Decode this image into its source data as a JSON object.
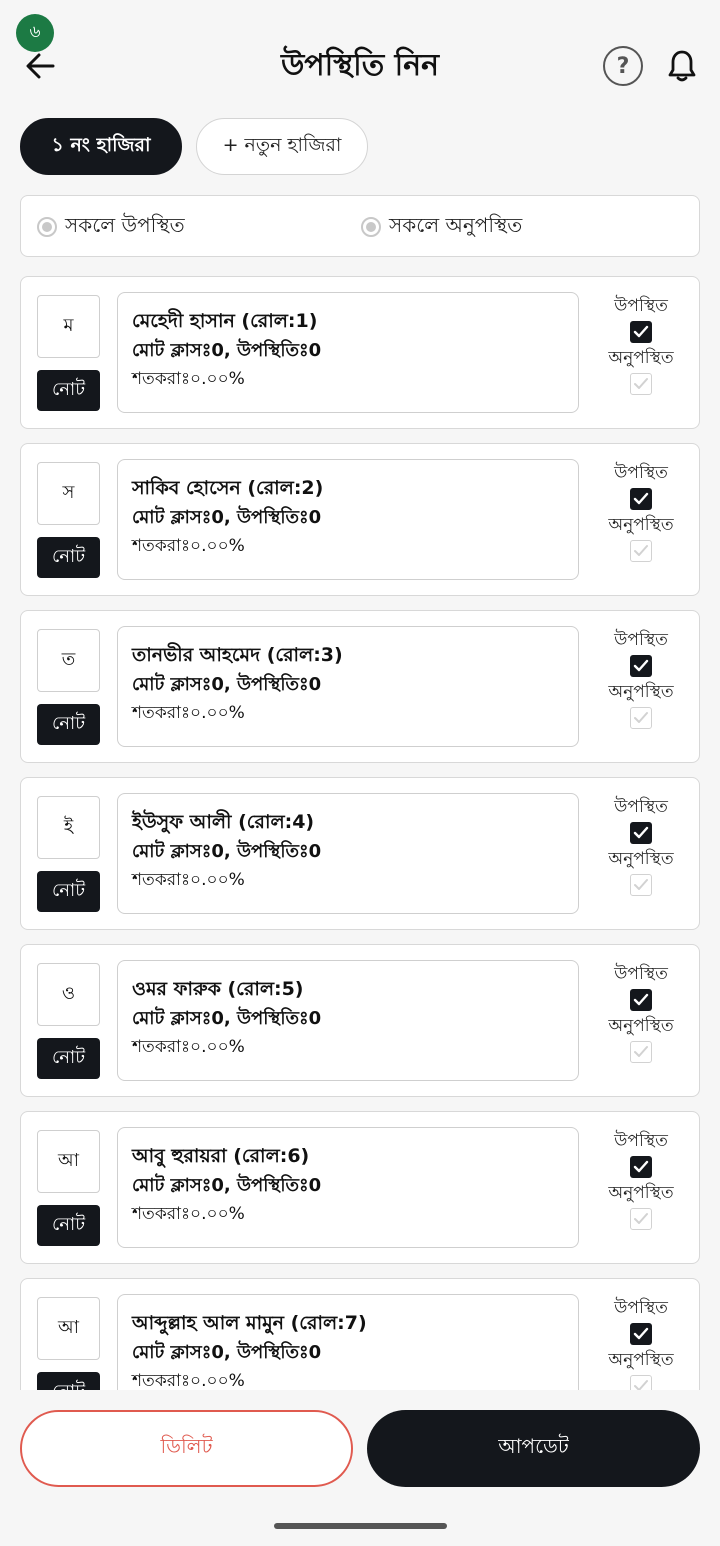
{
  "status_badge": "৬",
  "header": {
    "title": "উপস্থিতি নিন",
    "help_symbol": "?"
  },
  "sessions": {
    "active_label": "১ নং হাজিরা",
    "new_label": "+ নতুন হাজিরা"
  },
  "bulk": {
    "all_present": "সকলে উপস্থিত",
    "all_absent": "সকলে অনুপস্থিত"
  },
  "labels": {
    "present": "উপস্থিত",
    "absent": "অনুপস্থিত",
    "note": "নোট"
  },
  "students": [
    {
      "initial": "ম",
      "name": "মেহেদী হাসান (রোল:1)",
      "stats": "মোট ক্লাসঃ0, উপস্থিতিঃ0",
      "percent": "শতকরাঃ০.০০%",
      "present": true,
      "absent": false
    },
    {
      "initial": "স",
      "name": "সাকিব হোসেন (রোল:2)",
      "stats": "মোট ক্লাসঃ0, উপস্থিতিঃ0",
      "percent": "শতকরাঃ০.০০%",
      "present": true,
      "absent": false
    },
    {
      "initial": "ত",
      "name": "তানভীর আহমেদ (রোল:3)",
      "stats": "মোট ক্লাসঃ0, উপস্থিতিঃ0",
      "percent": "শতকরাঃ০.০০%",
      "present": true,
      "absent": false
    },
    {
      "initial": "ই",
      "name": "ইউসুফ আলী (রোল:4)",
      "stats": "মোট ক্লাসঃ0, উপস্থিতিঃ0",
      "percent": "শতকরাঃ০.০০%",
      "present": true,
      "absent": false
    },
    {
      "initial": "ও",
      "name": "ওমর ফারুক (রোল:5)",
      "stats": "মোট ক্লাসঃ0, উপস্থিতিঃ0",
      "percent": "শতকরাঃ০.০০%",
      "present": true,
      "absent": false
    },
    {
      "initial": "আ",
      "name": "আবু হুরায়রা (রোল:6)",
      "stats": "মোট ক্লাসঃ0, উপস্থিতিঃ0",
      "percent": "শতকরাঃ০.০০%",
      "present": true,
      "absent": false
    },
    {
      "initial": "আ",
      "name": "আব্দুল্লাহ আল মামুন (রোল:7)",
      "stats": "মোট ক্লাসঃ0, উপস্থিতিঃ0",
      "percent": "শতকরাঃ০.০০%",
      "present": true,
      "absent": false
    }
  ],
  "actions": {
    "delete_label": "ডিলিট",
    "update_label": "আপডেট"
  },
  "colors": {
    "primary": "#14171c",
    "danger": "#e05a4f",
    "badge": "#1c7a44"
  }
}
